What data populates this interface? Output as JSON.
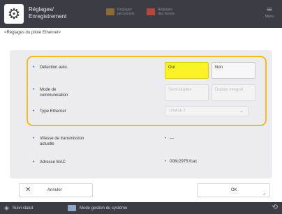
{
  "header": {
    "settings_icon": "gear-icon",
    "title_line1": "Réglages/",
    "title_line2": "Enregistrement",
    "btn1_line1": "Réglages",
    "btn1_line2": "personnels",
    "btn2_line1": "Réglages",
    "btn2_line2": "des favoris",
    "menu_label": "Menu"
  },
  "breadcrumb": "<Réglages du pilote Ethernet>",
  "settings": [
    {
      "label": "Détection auto.",
      "options": [
        "Oui",
        "Non"
      ],
      "selected": "Oui"
    },
    {
      "label_line1": "Mode de",
      "label_line2": "communication",
      "options": [
        "Semi-duplex",
        "Duplex intégral"
      ],
      "disabled": true
    },
    {
      "label": "Type Ethernet",
      "select_value": "10BASE-T",
      "disabled": true
    }
  ],
  "info": [
    {
      "label_line1": "Vitesse de transmission",
      "label_line2": "actuelle",
      "value": "---"
    },
    {
      "label": "Adresse MAC",
      "value": "008c2975:fcac"
    }
  ],
  "footer": {
    "cancel_label": "Annuler",
    "ok_label": "OK"
  },
  "statusbar": {
    "status_monitor": "Suivi statut",
    "system_mode": "Mode gestion du système"
  },
  "colors": {
    "highlight": "#f5b921",
    "selected": "#fcf228",
    "header_bg": "#3c3c44"
  }
}
